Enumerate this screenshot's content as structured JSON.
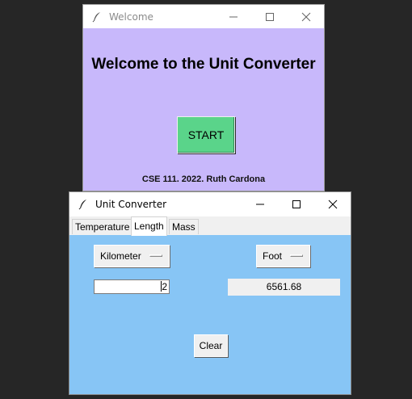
{
  "welcome_window": {
    "title": "Welcome",
    "heading": "Welcome to the Unit Converter",
    "start_label": "START",
    "credit": "CSE 111. 2022. Ruth Cardona",
    "background": "#c8b8fb",
    "start_color": "#5ad48a"
  },
  "converter_window": {
    "title": "Unit Converter",
    "tabs": [
      {
        "label": "Temperature",
        "active": false
      },
      {
        "label": "Length",
        "active": true
      },
      {
        "label": "Mass",
        "active": false
      }
    ],
    "from_unit": "Kilometer",
    "to_unit": "Foot",
    "input_value": "2",
    "result_value": "6561.68",
    "clear_label": "Clear",
    "panel_color": "#87c5f5"
  },
  "icons": {
    "app": "feather-icon",
    "minimize": "minimize-icon",
    "maximize": "maximize-icon",
    "close": "close-icon"
  }
}
